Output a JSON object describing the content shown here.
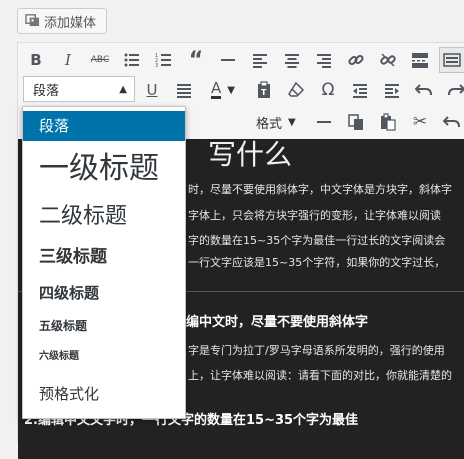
{
  "add_media": {
    "label": "添加媒体",
    "icon": "media-icon"
  },
  "toolbar": {
    "block_format": "段落",
    "format_menu": "格式"
  },
  "content": {
    "title": "写什么",
    "lines": [
      "时，尽量不要使用斜体字，中文字体是方块字，斜体字",
      "字体上，只会将方块字强行的变形，让字体难以阅读",
      "字的数量在15~35个字为最佳一行过长的文字阅读会",
      "一行文字应该是15~35个字符，如果你的文字过长，"
    ],
    "heading2": "编中文时，尽量不要使用斜体字",
    "lines2": [
      "字是专门为拉丁/罗马字母语系所发明的，强行的使用",
      "上，让字体难以阅读：请看下面的对比，你就能清楚的"
    ],
    "heading3": "2.编辑中文文字时，一行文字的数量在15~35个字为最佳"
  },
  "format_dropdown": {
    "items": [
      {
        "label": "段落",
        "selected": true
      },
      {
        "label": "一级标题"
      },
      {
        "label": "二级标题"
      },
      {
        "label": "三级标题"
      },
      {
        "label": "四级标题"
      },
      {
        "label": "五级标题"
      },
      {
        "label": "六级标题"
      },
      {
        "label": "预格式化"
      }
    ]
  }
}
